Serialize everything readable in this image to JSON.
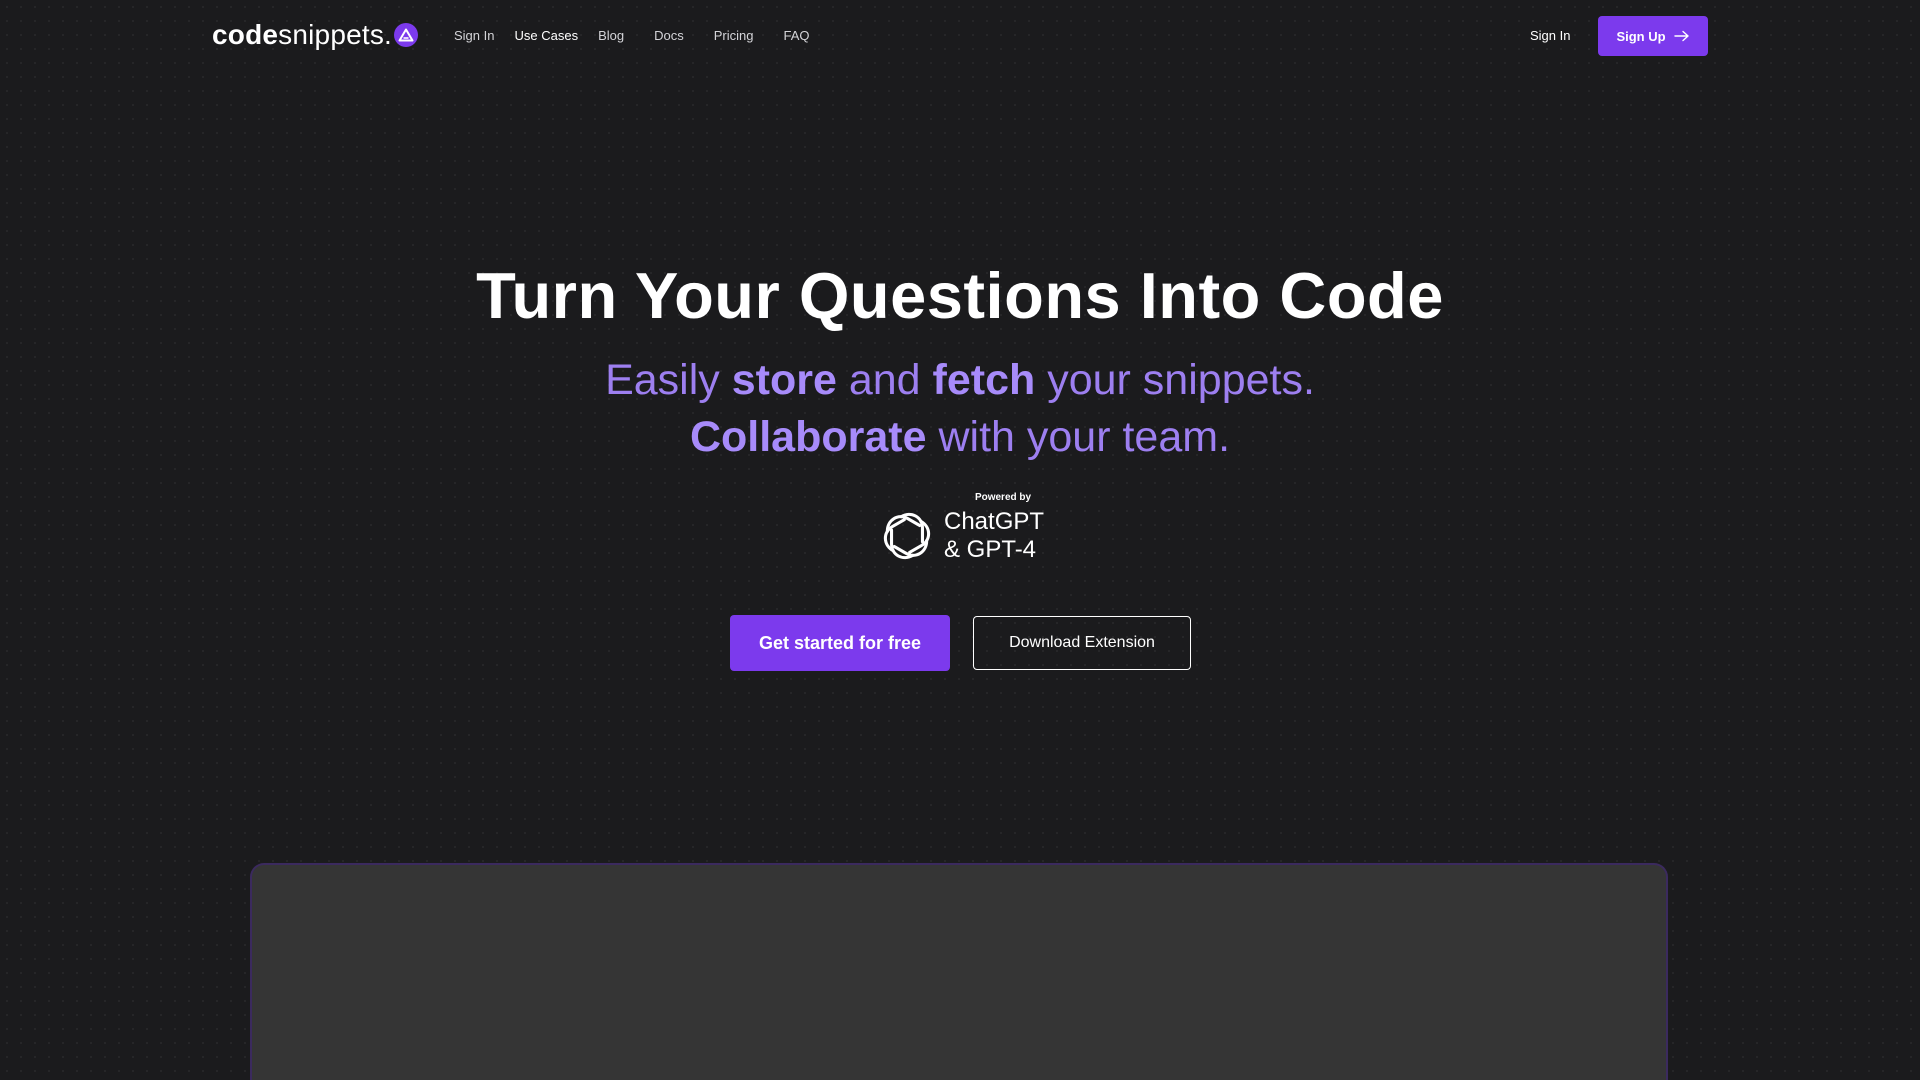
{
  "header": {
    "logo": {
      "bold": "code",
      "light": "snippets.",
      "icon": "logo-mark-icon"
    },
    "nav": [
      {
        "label": "Sign In",
        "active": false
      },
      {
        "label": "Use Cases",
        "active": true
      },
      {
        "label": "Blog",
        "active": false
      },
      {
        "label": "Docs",
        "active": false
      },
      {
        "label": "Pricing",
        "active": false
      },
      {
        "label": "FAQ",
        "active": false
      }
    ],
    "signin_label": "Sign In",
    "signup_label": "Sign Up",
    "signup_icon": "arrow-right-icon"
  },
  "hero": {
    "title": "Turn Your Questions Into Code",
    "subtitle": {
      "part1": "Easily ",
      "bold1": "store",
      "part2": " and ",
      "bold2": "fetch",
      "part3": " your snippets.",
      "bold3": "Collaborate",
      "part4": " with your team."
    },
    "powered_label": "Powered by",
    "powered_line1": "ChatGPT",
    "powered_line2": "& GPT-4",
    "powered_icon": "openai-icon",
    "cta_primary": "Get started for free",
    "cta_secondary": "Download Extension"
  },
  "colors": {
    "background": "#1b1b1d",
    "accent": "#7c3aed",
    "accent_text": "#a78bfa",
    "panel": "#353535"
  }
}
